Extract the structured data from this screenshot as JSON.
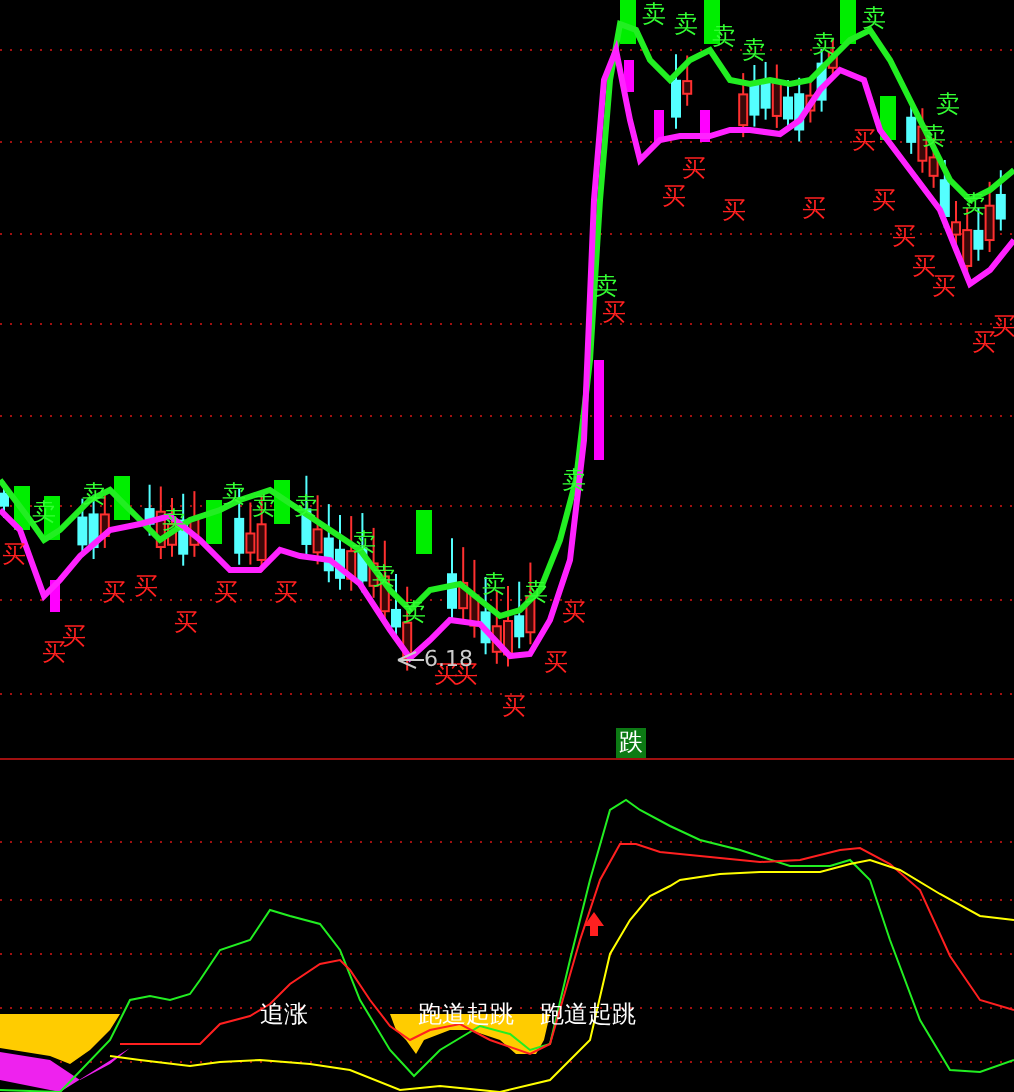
{
  "price_panel": {
    "sell_signals": [
      "卖",
      "卖",
      "卖",
      "卖",
      "卖",
      "卖",
      "卖",
      "卖",
      "卖",
      "卖",
      "卖",
      "卖",
      "卖",
      "卖",
      "卖",
      "卖",
      "卖",
      "卖",
      "卖",
      "卖",
      "卖",
      "卖"
    ],
    "buy_signals": [
      "买",
      "买",
      "买",
      "买",
      "买",
      "买",
      "买",
      "买",
      "买",
      "买",
      "买",
      "买",
      "买",
      "买",
      "买",
      "买",
      "买",
      "买",
      "买",
      "买",
      "买",
      "买",
      "买",
      "买",
      "买"
    ],
    "low_price_label": "6.18",
    "fall_badge": "跌"
  },
  "indicator_panel": {
    "signals": [
      {
        "text": "追涨"
      },
      {
        "text": "跑道起跳"
      },
      {
        "text": "跑道起跳"
      }
    ]
  }
}
